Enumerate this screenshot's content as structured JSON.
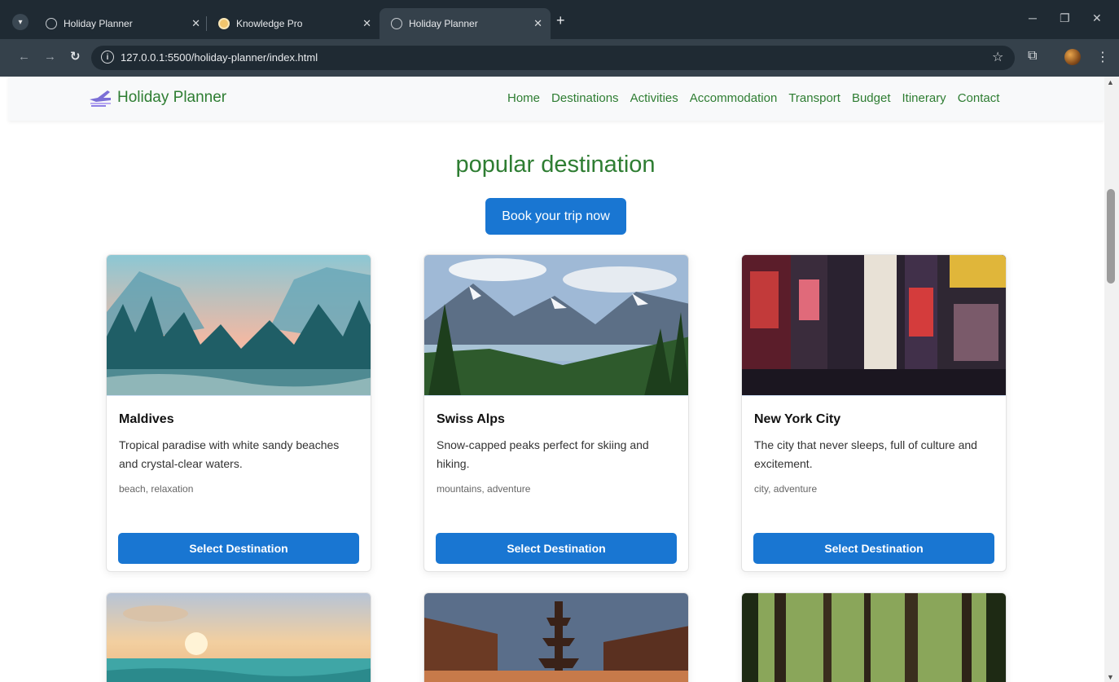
{
  "browser": {
    "tabs": [
      {
        "title": "Holiday Planner",
        "favicon": "globe-icon",
        "active": false
      },
      {
        "title": "Knowledge Pro",
        "favicon": "knowledge-pro-favicon",
        "active": false
      },
      {
        "title": "Holiday Planner",
        "favicon": "globe-icon",
        "active": true
      }
    ],
    "url": "127.0.0.1:5500/holiday-planner/index.html"
  },
  "site": {
    "brand": "Holiday Planner",
    "nav": [
      "Home",
      "Destinations",
      "Activities",
      "Accommodation",
      "Transport",
      "Budget",
      "Itinerary",
      "Contact"
    ]
  },
  "main": {
    "title": "popular destination",
    "book_button": "Book your trip now",
    "select_label": "Select Destination",
    "destinations": [
      {
        "name": "Maldives",
        "description": "Tropical paradise with white sandy beaches and crystal-clear waters.",
        "tags": "beach, relaxation"
      },
      {
        "name": "Swiss Alps",
        "description": "Snow-capped peaks perfect for skiing and hiking.",
        "tags": "mountains, adventure"
      },
      {
        "name": "New York City",
        "description": "The city that never sleeps, full of culture and excitement.",
        "tags": "city, adventure"
      }
    ]
  },
  "colors": {
    "accent": "#1976d2",
    "brand_green": "#2e7d32"
  }
}
